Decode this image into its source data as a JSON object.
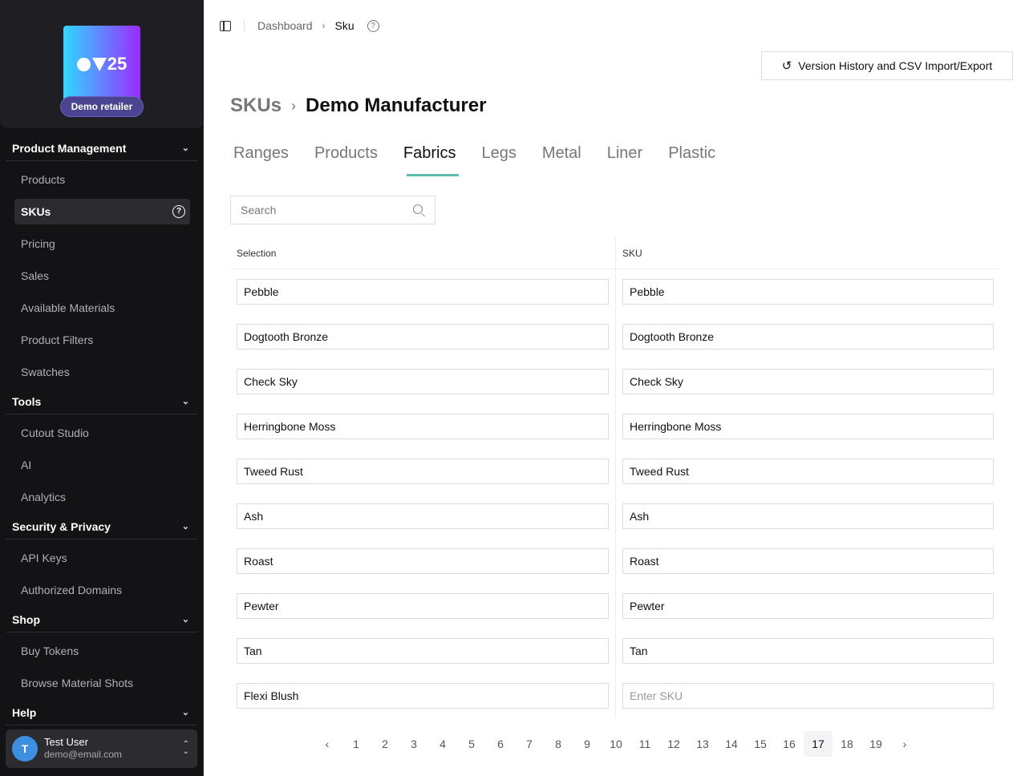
{
  "brand": {
    "logo_text": "OV25",
    "badge": "Demo retailer",
    "gradient": [
      "#2fd8ff",
      "#9b2cff"
    ]
  },
  "sidebar": {
    "sections": [
      {
        "label": "Product Management",
        "items": [
          {
            "label": "Products"
          },
          {
            "label": "SKUs",
            "active": true
          },
          {
            "label": "Pricing"
          },
          {
            "label": "Sales"
          },
          {
            "label": "Available Materials"
          },
          {
            "label": "Product Filters"
          },
          {
            "label": "Swatches"
          }
        ]
      },
      {
        "label": "Tools",
        "items": [
          {
            "label": "Cutout Studio"
          },
          {
            "label": "AI"
          },
          {
            "label": "Analytics"
          }
        ]
      },
      {
        "label": "Security & Privacy",
        "items": [
          {
            "label": "API Keys"
          },
          {
            "label": "Authorized Domains"
          }
        ]
      },
      {
        "label": "Shop",
        "items": [
          {
            "label": "Buy Tokens"
          },
          {
            "label": "Browse Material Shots"
          }
        ]
      },
      {
        "label": "Help",
        "items": []
      }
    ],
    "user": {
      "initial": "T",
      "name": "Test User",
      "email": "demo@email.com"
    }
  },
  "breadcrumb": {
    "parent": "Dashboard",
    "current": "Sku"
  },
  "toolbar": {
    "version_history_label": "Version History and CSV Import/Export"
  },
  "title": {
    "parent": "SKUs",
    "current": "Demo Manufacturer"
  },
  "tabs": [
    {
      "label": "Ranges"
    },
    {
      "label": "Products"
    },
    {
      "label": "Fabrics",
      "active": true
    },
    {
      "label": "Legs"
    },
    {
      "label": "Metal"
    },
    {
      "label": "Liner"
    },
    {
      "label": "Plastic"
    }
  ],
  "accent": "#5bbcb0",
  "search": {
    "placeholder": "Search",
    "value": ""
  },
  "table": {
    "headers": [
      "Selection",
      "SKU"
    ],
    "sku_placeholder": "Enter SKU",
    "rows": [
      [
        "Pebble",
        "Pebble"
      ],
      [
        "Dogtooth Bronze",
        "Dogtooth Bronze"
      ],
      [
        "Check Sky",
        "Check Sky"
      ],
      [
        "Herringbone Moss",
        "Herringbone Moss"
      ],
      [
        "Tweed Rust",
        "Tweed Rust"
      ],
      [
        "Ash",
        "Ash"
      ],
      [
        "Roast",
        "Roast"
      ],
      [
        "Pewter",
        "Pewter"
      ],
      [
        "Tan",
        "Tan"
      ],
      [
        "Flexi Blush",
        ""
      ]
    ]
  },
  "pagination": {
    "pages": [
      "1",
      "2",
      "3",
      "4",
      "5",
      "6",
      "7",
      "8",
      "9",
      "10",
      "11",
      "12",
      "13",
      "14",
      "15",
      "16",
      "17",
      "18",
      "19"
    ],
    "current": "17",
    "prev": "‹",
    "next": "›"
  }
}
